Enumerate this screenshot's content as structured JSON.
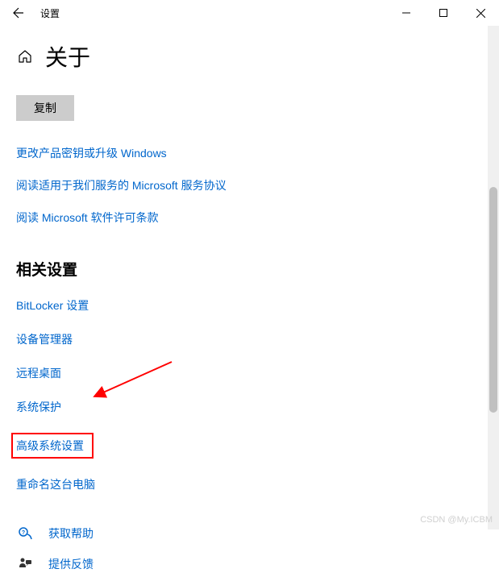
{
  "window": {
    "app_title": "设置"
  },
  "page": {
    "title": "关于",
    "copy_button": "复制"
  },
  "main_links": [
    "更改产品密钥或升级 Windows",
    "阅读适用于我们服务的 Microsoft 服务协议",
    "阅读 Microsoft 软件许可条款"
  ],
  "related": {
    "title": "相关设置",
    "items": [
      "BitLocker 设置",
      "设备管理器",
      "远程桌面",
      "系统保护",
      "高级系统设置",
      "重命名这台电脑"
    ],
    "highlighted_index": 4
  },
  "footer": {
    "help": "获取帮助",
    "feedback": "提供反馈"
  },
  "watermark": "CSDN @My.ICBM",
  "colors": {
    "link": "#0066cc",
    "highlight_border": "#ff0000",
    "button_bg": "#cccccc"
  }
}
